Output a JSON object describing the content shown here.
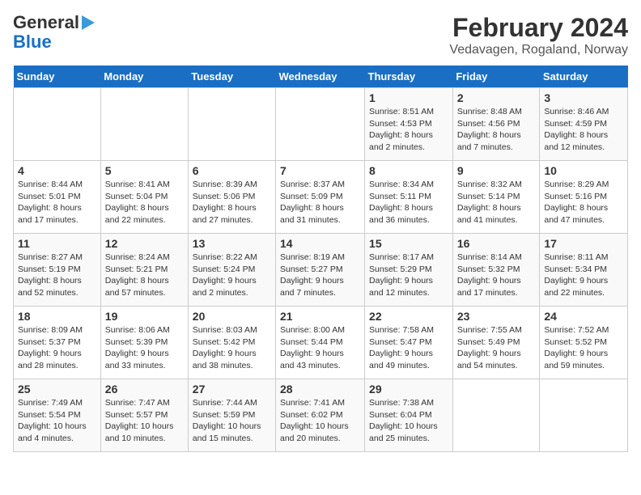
{
  "header": {
    "logo_line1": "General",
    "logo_line2": "Blue",
    "title": "February 2024",
    "subtitle": "Vedavagen, Rogaland, Norway"
  },
  "weekdays": [
    "Sunday",
    "Monday",
    "Tuesday",
    "Wednesday",
    "Thursday",
    "Friday",
    "Saturday"
  ],
  "weeks": [
    [
      {
        "day": "",
        "info": ""
      },
      {
        "day": "",
        "info": ""
      },
      {
        "day": "",
        "info": ""
      },
      {
        "day": "",
        "info": ""
      },
      {
        "day": "1",
        "info": "Sunrise: 8:51 AM\nSunset: 4:53 PM\nDaylight: 8 hours\nand 2 minutes."
      },
      {
        "day": "2",
        "info": "Sunrise: 8:48 AM\nSunset: 4:56 PM\nDaylight: 8 hours\nand 7 minutes."
      },
      {
        "day": "3",
        "info": "Sunrise: 8:46 AM\nSunset: 4:59 PM\nDaylight: 8 hours\nand 12 minutes."
      }
    ],
    [
      {
        "day": "4",
        "info": "Sunrise: 8:44 AM\nSunset: 5:01 PM\nDaylight: 8 hours\nand 17 minutes."
      },
      {
        "day": "5",
        "info": "Sunrise: 8:41 AM\nSunset: 5:04 PM\nDaylight: 8 hours\nand 22 minutes."
      },
      {
        "day": "6",
        "info": "Sunrise: 8:39 AM\nSunset: 5:06 PM\nDaylight: 8 hours\nand 27 minutes."
      },
      {
        "day": "7",
        "info": "Sunrise: 8:37 AM\nSunset: 5:09 PM\nDaylight: 8 hours\nand 31 minutes."
      },
      {
        "day": "8",
        "info": "Sunrise: 8:34 AM\nSunset: 5:11 PM\nDaylight: 8 hours\nand 36 minutes."
      },
      {
        "day": "9",
        "info": "Sunrise: 8:32 AM\nSunset: 5:14 PM\nDaylight: 8 hours\nand 41 minutes."
      },
      {
        "day": "10",
        "info": "Sunrise: 8:29 AM\nSunset: 5:16 PM\nDaylight: 8 hours\nand 47 minutes."
      }
    ],
    [
      {
        "day": "11",
        "info": "Sunrise: 8:27 AM\nSunset: 5:19 PM\nDaylight: 8 hours\nand 52 minutes."
      },
      {
        "day": "12",
        "info": "Sunrise: 8:24 AM\nSunset: 5:21 PM\nDaylight: 8 hours\nand 57 minutes."
      },
      {
        "day": "13",
        "info": "Sunrise: 8:22 AM\nSunset: 5:24 PM\nDaylight: 9 hours\nand 2 minutes."
      },
      {
        "day": "14",
        "info": "Sunrise: 8:19 AM\nSunset: 5:27 PM\nDaylight: 9 hours\nand 7 minutes."
      },
      {
        "day": "15",
        "info": "Sunrise: 8:17 AM\nSunset: 5:29 PM\nDaylight: 9 hours\nand 12 minutes."
      },
      {
        "day": "16",
        "info": "Sunrise: 8:14 AM\nSunset: 5:32 PM\nDaylight: 9 hours\nand 17 minutes."
      },
      {
        "day": "17",
        "info": "Sunrise: 8:11 AM\nSunset: 5:34 PM\nDaylight: 9 hours\nand 22 minutes."
      }
    ],
    [
      {
        "day": "18",
        "info": "Sunrise: 8:09 AM\nSunset: 5:37 PM\nDaylight: 9 hours\nand 28 minutes."
      },
      {
        "day": "19",
        "info": "Sunrise: 8:06 AM\nSunset: 5:39 PM\nDaylight: 9 hours\nand 33 minutes."
      },
      {
        "day": "20",
        "info": "Sunrise: 8:03 AM\nSunset: 5:42 PM\nDaylight: 9 hours\nand 38 minutes."
      },
      {
        "day": "21",
        "info": "Sunrise: 8:00 AM\nSunset: 5:44 PM\nDaylight: 9 hours\nand 43 minutes."
      },
      {
        "day": "22",
        "info": "Sunrise: 7:58 AM\nSunset: 5:47 PM\nDaylight: 9 hours\nand 49 minutes."
      },
      {
        "day": "23",
        "info": "Sunrise: 7:55 AM\nSunset: 5:49 PM\nDaylight: 9 hours\nand 54 minutes."
      },
      {
        "day": "24",
        "info": "Sunrise: 7:52 AM\nSunset: 5:52 PM\nDaylight: 9 hours\nand 59 minutes."
      }
    ],
    [
      {
        "day": "25",
        "info": "Sunrise: 7:49 AM\nSunset: 5:54 PM\nDaylight: 10 hours\nand 4 minutes."
      },
      {
        "day": "26",
        "info": "Sunrise: 7:47 AM\nSunset: 5:57 PM\nDaylight: 10 hours\nand 10 minutes."
      },
      {
        "day": "27",
        "info": "Sunrise: 7:44 AM\nSunset: 5:59 PM\nDaylight: 10 hours\nand 15 minutes."
      },
      {
        "day": "28",
        "info": "Sunrise: 7:41 AM\nSunset: 6:02 PM\nDaylight: 10 hours\nand 20 minutes."
      },
      {
        "day": "29",
        "info": "Sunrise: 7:38 AM\nSunset: 6:04 PM\nDaylight: 10 hours\nand 25 minutes."
      },
      {
        "day": "",
        "info": ""
      },
      {
        "day": "",
        "info": ""
      }
    ]
  ]
}
